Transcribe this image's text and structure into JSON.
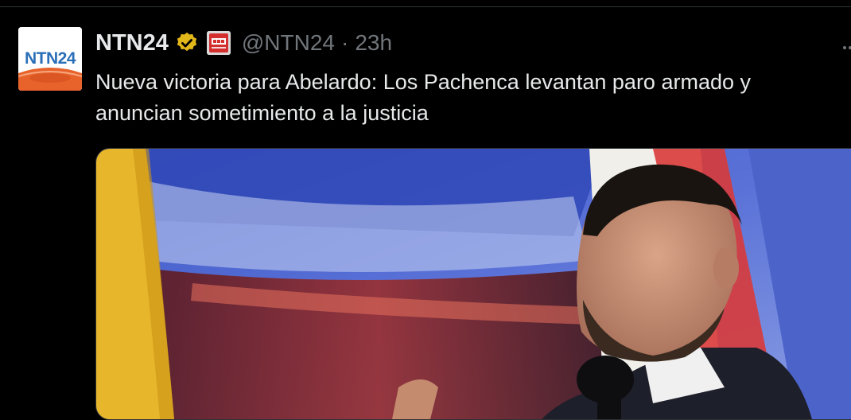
{
  "tweet": {
    "display_name": "NTN24",
    "handle": "@NTN24",
    "separator": "·",
    "time": "23h",
    "text": "Nueva victoria para Abelardo: Los Pachenca levantan paro armado y anuncian sometimiento a la justicia",
    "avatar_label": "NTN24",
    "verified_badge": "gold-verified-icon",
    "affiliation_badge": "rcn-affiliate-icon",
    "more_icon": "more-icon"
  },
  "colors": {
    "background": "#000000",
    "text_primary": "#e7e9ea",
    "text_secondary": "#71767b",
    "verified_gold": "#e2b719",
    "avatar_blue": "#2a6fb7",
    "avatar_orange": "#e8632b"
  }
}
